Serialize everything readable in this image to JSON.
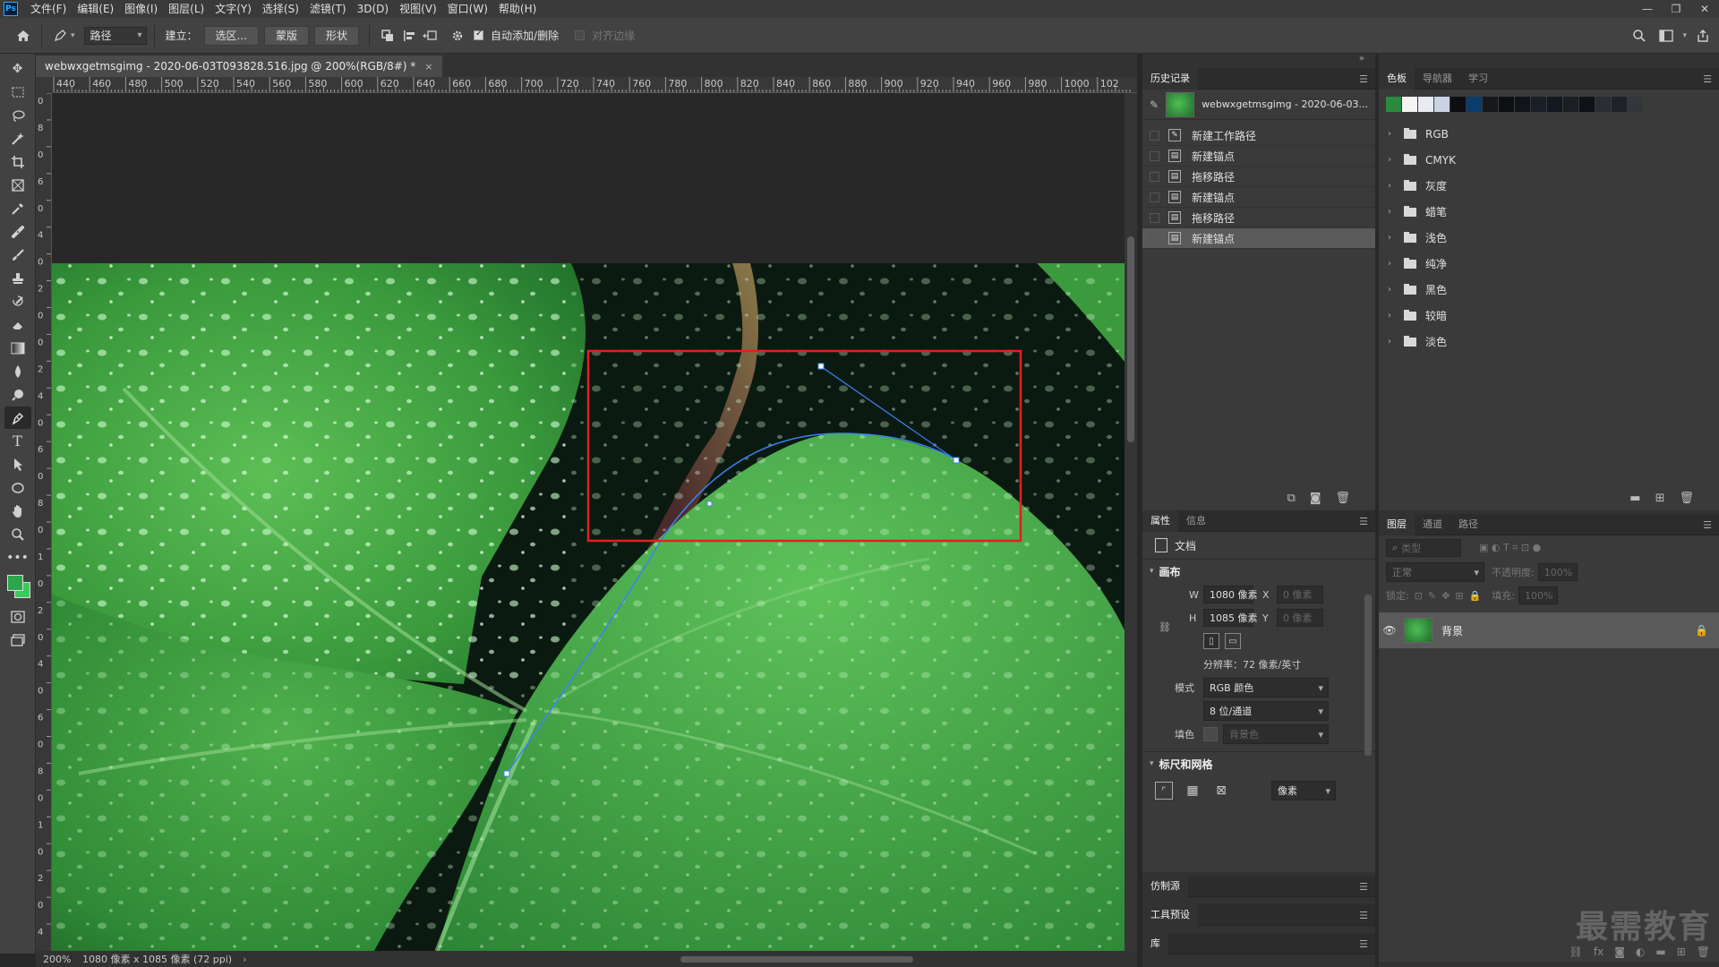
{
  "app": {
    "logo": "Ps"
  },
  "menu": [
    "文件(F)",
    "编辑(E)",
    "图像(I)",
    "图层(L)",
    "文字(Y)",
    "选择(S)",
    "滤镜(T)",
    "3D(D)",
    "视图(V)",
    "窗口(W)",
    "帮助(H)"
  ],
  "window_controls": [
    "—",
    "❐",
    "✕"
  ],
  "options": {
    "mode_value": "路径",
    "build_label": "建立：",
    "selection_btn": "选区...",
    "mask_btn": "蒙版",
    "shape_btn": "形状",
    "auto_add_delete": "自动添加/删除",
    "auto_add_checked": true,
    "align_edges": "对齐边缘"
  },
  "document": {
    "tab_title": "webwxgetmsgimg - 2020-06-03T093828.516.jpg @ 200%(RGB/8#) *",
    "close_symbol": "×",
    "zoom": "200%",
    "doc_info": "1080 像素 x 1085 像素 (72 ppi)",
    "ruler_h": [
      "440",
      "460",
      "480",
      "500",
      "520",
      "540",
      "560",
      "580",
      "600",
      "620",
      "640",
      "660",
      "680",
      "700",
      "720",
      "740",
      "760",
      "780",
      "800",
      "820",
      "840",
      "860",
      "880",
      "900",
      "920",
      "940",
      "960",
      "980",
      "1000",
      "102"
    ],
    "ruler_v": [
      "0",
      "8",
      "0",
      "6",
      "0",
      "4",
      "0",
      "2",
      "0",
      "0",
      "2",
      "4",
      "0",
      "6",
      "0",
      "8",
      "0",
      "1",
      "0",
      "2",
      "0",
      "4",
      "0",
      "6",
      "0",
      "8",
      "0",
      "1",
      "0",
      "2",
      "0",
      "4"
    ]
  },
  "history": {
    "tab": "历史记录",
    "snapshot_name": "webwxgetmsgimg - 2020-06-03...",
    "items": [
      "新建工作路径",
      "新建锚点",
      "拖移路径",
      "新建锚点",
      "拖移路径",
      "新建锚点"
    ],
    "active_index": 5
  },
  "properties": {
    "tabs": [
      "属性",
      "信息"
    ],
    "doc_label": "文档",
    "canvas_section": "画布",
    "w_label": "W",
    "w_value": "1080 像素",
    "x_label": "X",
    "x_value": "0 像素",
    "h_label": "H",
    "h_value": "1085 像素",
    "y_label": "Y",
    "y_value": "0 像素",
    "resolution": "分辨率：72 像素/英寸",
    "mode_label": "模式",
    "mode_value": "RGB 颜色",
    "depth_value": "8 位/通道",
    "fill_label": "填色",
    "fill_value": "背景色",
    "rulers_section": "标尺和网格",
    "unit_value": "像素"
  },
  "collapsed_panels": [
    "仿制源",
    "工具预设",
    "库"
  ],
  "swatches": {
    "tabs": [
      "色板",
      "导航器",
      "学习"
    ],
    "colors": [
      "#2a8a3e",
      "#f4f4f4",
      "#e8ecf2",
      "#c9d3e3",
      "#0d0d12",
      "#0a3c6c",
      "#15191e",
      "#0e0f12",
      "#111418",
      "#1a1f27",
      "#121820",
      "#1a1f24",
      "#0e1216",
      "#2a2d31",
      "#1e2125",
      "#33363a"
    ],
    "folders": [
      "RGB",
      "CMYK",
      "灰度",
      "蜡笔",
      "浅色",
      "纯净",
      "黑色",
      "较暗",
      "淡色"
    ]
  },
  "layers": {
    "tabs": [
      "图层",
      "通道",
      "路径"
    ],
    "search_placeholder": "类型",
    "blend_mode": "正常",
    "opacity_label": "不透明度:",
    "opacity_value": "100%",
    "lock_label": "锁定:",
    "fill_label": "填充:",
    "fill_value": "100%",
    "layer_name": "背景"
  },
  "watermark": "最需教育"
}
